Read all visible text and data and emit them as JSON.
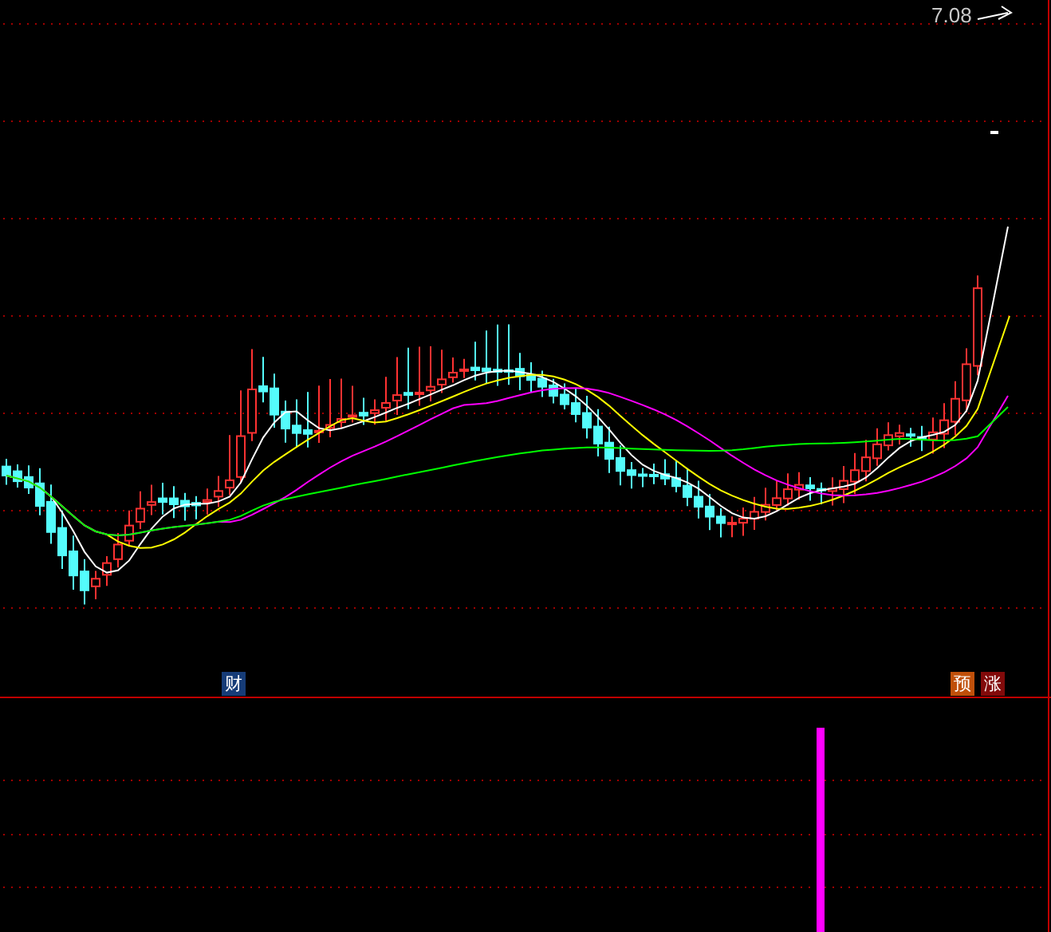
{
  "price_label": "7.08",
  "signals": [
    {
      "label": "财",
      "color": "#163c78"
    },
    {
      "label": "预",
      "color": "#c0500a"
    },
    {
      "label": "涨",
      "color": "#820a0a"
    }
  ]
}
